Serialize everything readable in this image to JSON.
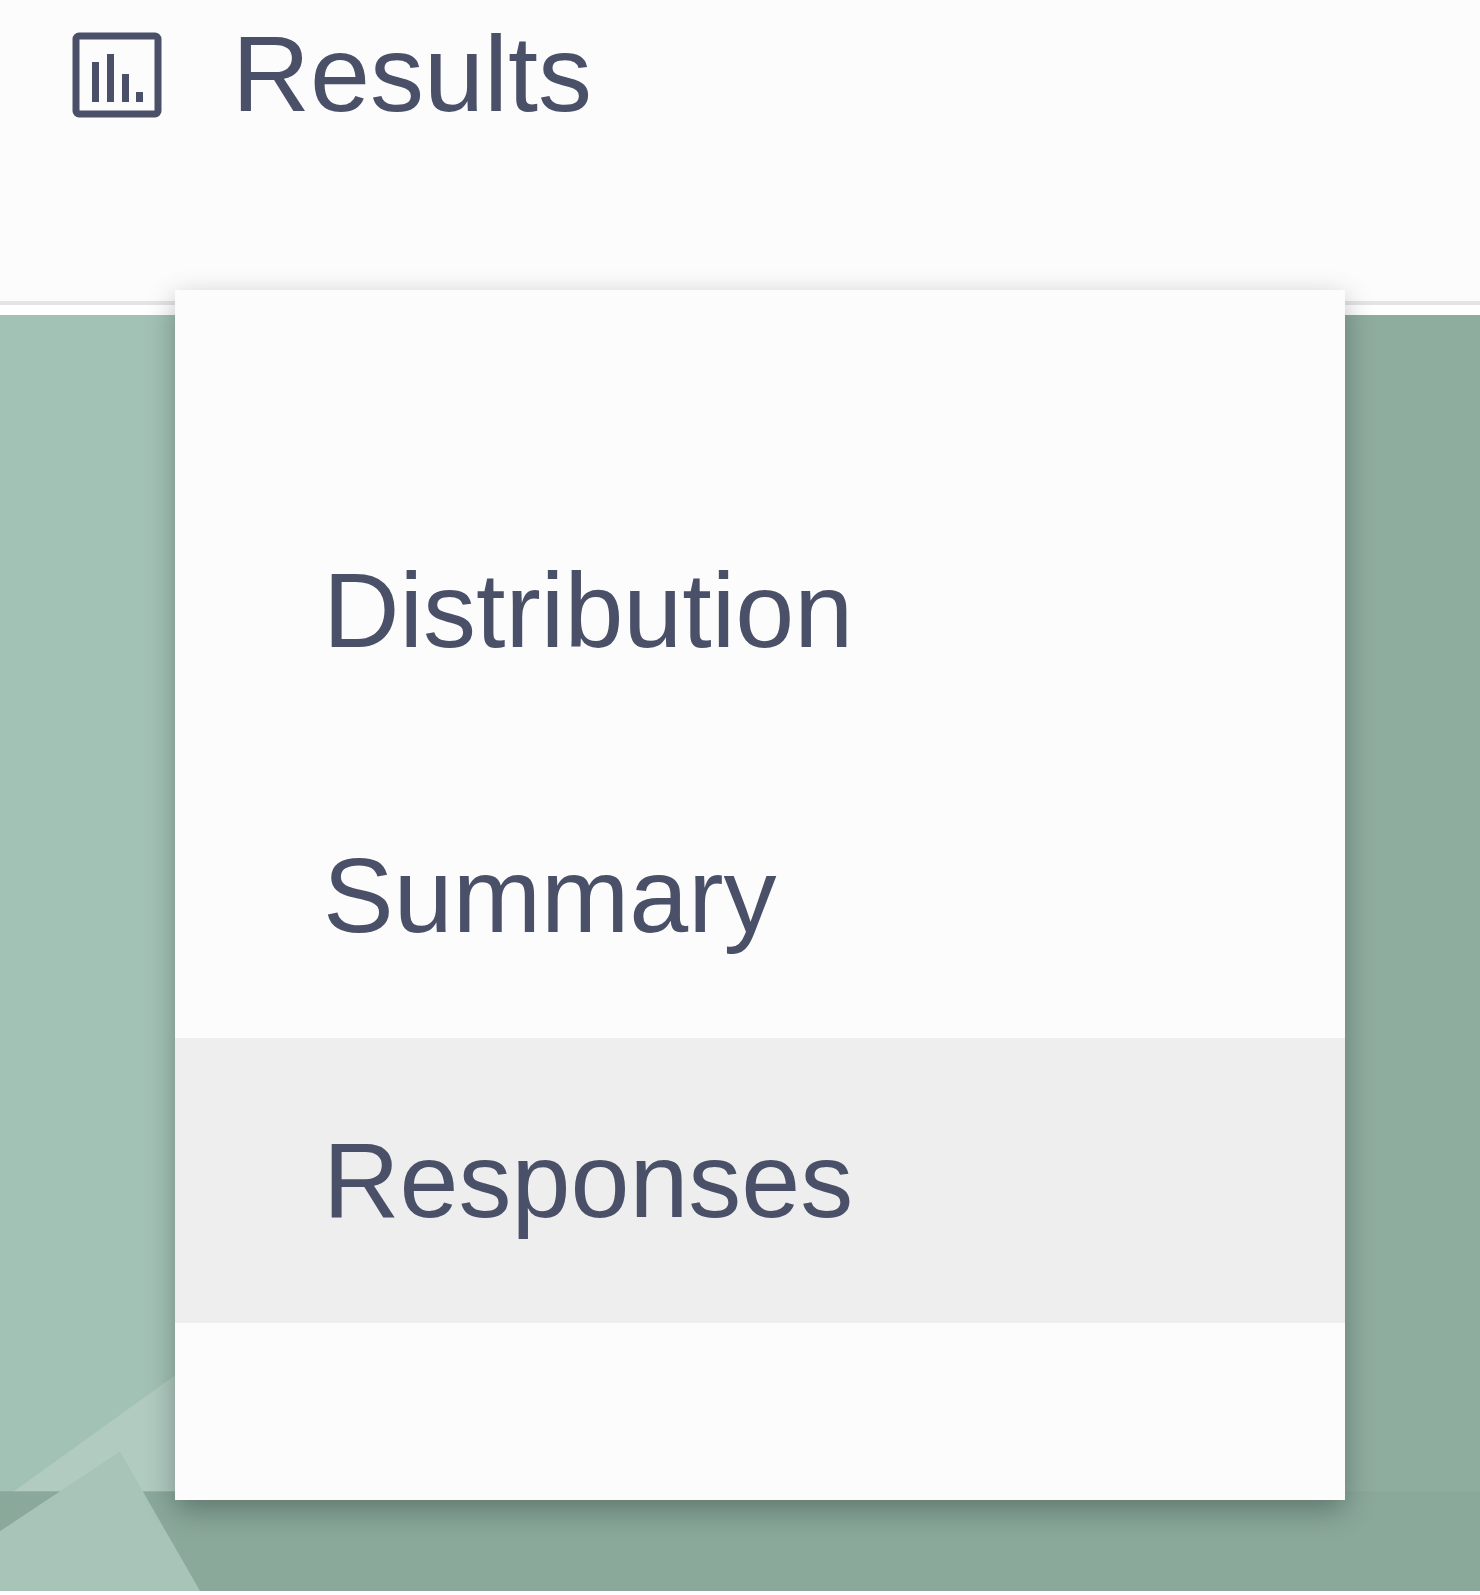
{
  "header": {
    "title": "Results"
  },
  "menu": {
    "items": [
      {
        "label": "Distribution",
        "selected": false
      },
      {
        "label": "Summary",
        "selected": false
      },
      {
        "label": "Responses",
        "selected": true
      }
    ]
  }
}
